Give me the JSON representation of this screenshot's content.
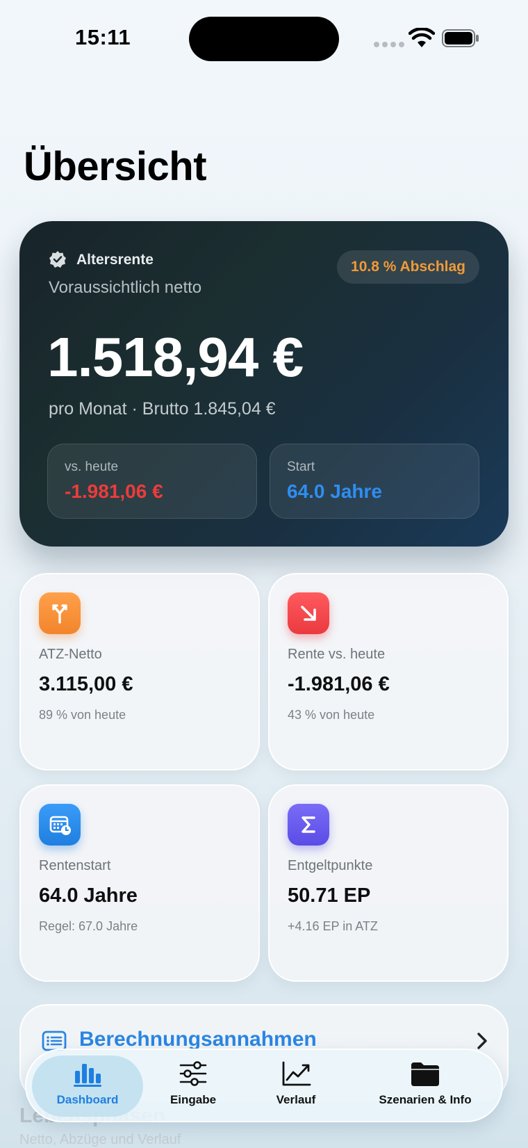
{
  "status_bar": {
    "time": "15:11"
  },
  "page": {
    "title": "Übersicht"
  },
  "hero": {
    "category": "Altersrente",
    "subtitle": "Voraussichtlich netto",
    "pill": "10.8 % Abschlag",
    "amount": "1.518,94 €",
    "detail": "pro Monat · Brutto 1.845,04 €",
    "boxes": [
      {
        "label": "vs. heute",
        "value": "-1.981,06 €",
        "color": "#ee3b3b"
      },
      {
        "label": "Start",
        "value": "64.0 Jahre",
        "color": "#2f8ef0"
      }
    ]
  },
  "tiles": [
    {
      "icon": "split-arrow-icon",
      "icon_color": "#f7903a",
      "label": "ATZ-Netto",
      "value": "3.115,00 €",
      "note": "89 % von heute"
    },
    {
      "icon": "arrow-down-right-icon",
      "icon_color": "#f0474c",
      "label": "Rente vs. heute",
      "value": "-1.981,06 €",
      "note": "43 % von heute"
    },
    {
      "icon": "calendar-clock-icon",
      "icon_color": "#2f8ef0",
      "label": "Rentenstart",
      "value": "64.0 Jahre",
      "note": "Regel: 67.0 Jahre"
    },
    {
      "icon": "sigma-icon",
      "icon_color": "#6a5cf0",
      "label": "Entgeltpunkte",
      "value": "50.71 EP",
      "note": "+4.16 EP in ATZ"
    }
  ],
  "assumptions": {
    "label": "Berechnungsannahmen"
  },
  "section": {
    "title": "Lebensphasen",
    "subtitle": "Netto, Abzüge und Verlauf"
  },
  "tabs": [
    {
      "label": "Dashboard",
      "icon": "bar-chart-icon",
      "active": true
    },
    {
      "label": "Eingabe",
      "icon": "sliders-icon",
      "active": false
    },
    {
      "label": "Verlauf",
      "icon": "trend-chart-icon",
      "active": false
    },
    {
      "label": "Szenarien & Info",
      "icon": "folder-icon",
      "active": false
    }
  ],
  "colors": {
    "accent": "#1f7fe0",
    "negative": "#ee3b3b",
    "warning": "#f29a38"
  }
}
